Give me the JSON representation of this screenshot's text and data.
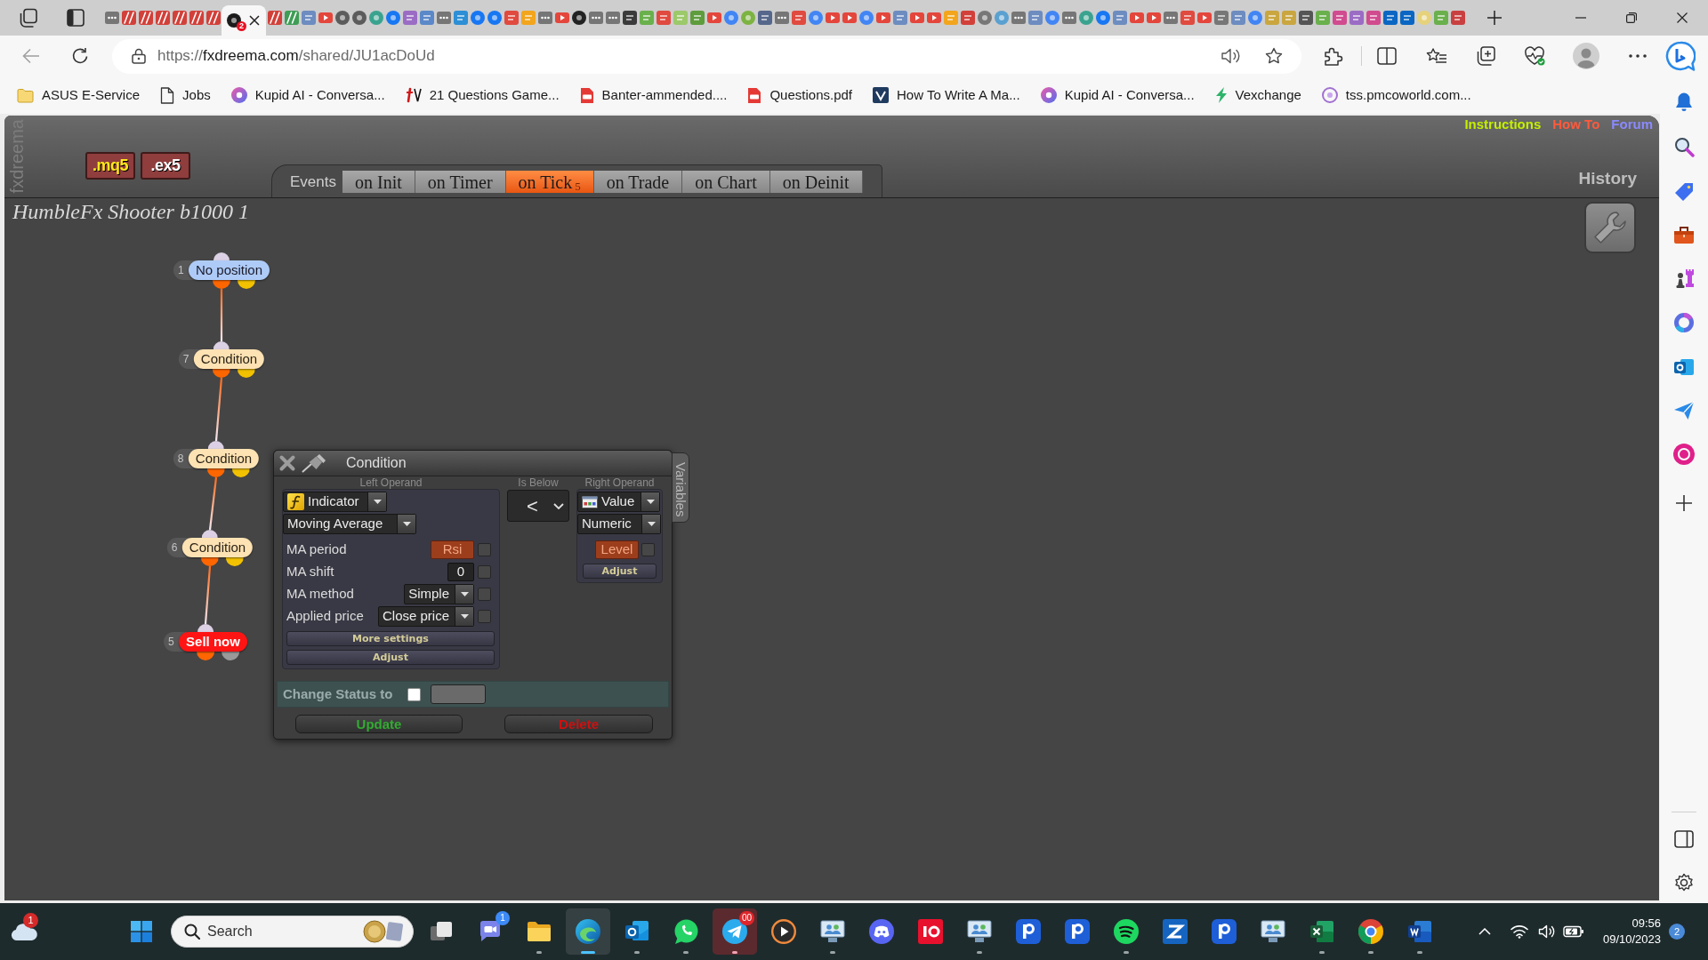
{
  "browser": {
    "tabs": [
      {
        "kind": "page",
        "color": "#767676",
        "selected": false
      },
      {
        "kind": "stripes",
        "color": "#d2403a",
        "selected": false
      },
      {
        "kind": "stripes",
        "color": "#d2403a",
        "selected": false
      },
      {
        "kind": "stripes",
        "color": "#d2403a",
        "selected": false
      },
      {
        "kind": "stripes",
        "color": "#d2403a",
        "selected": false
      },
      {
        "kind": "stripes",
        "color": "#d2403a",
        "selected": false
      },
      {
        "kind": "stripes",
        "color": "#d2403a",
        "selected": false
      },
      {
        "kind": "round",
        "color": "#1c1c1c",
        "badge": "2",
        "selected": true
      },
      {
        "kind": "stripes",
        "color": "#d2403a",
        "selected": false
      },
      {
        "kind": "stripes",
        "color": "#3f9d55",
        "selected": false
      },
      {
        "kind": "square",
        "color": "#6d8cc0",
        "selected": false
      },
      {
        "kind": "play",
        "color": "#e4463c",
        "selected": false
      },
      {
        "kind": "round",
        "color": "#5c5c5c",
        "selected": false
      },
      {
        "kind": "round",
        "color": "#5c5c5c",
        "selected": false
      },
      {
        "kind": "round",
        "color": "#3aa38f",
        "selected": false
      },
      {
        "kind": "round",
        "color": "#1877f2",
        "selected": false
      },
      {
        "kind": "square",
        "color": "#9b6cc4",
        "selected": false
      },
      {
        "kind": "square",
        "color": "#5b88c8",
        "selected": false
      },
      {
        "kind": "page",
        "color": "#767676",
        "selected": false
      },
      {
        "kind": "square",
        "color": "#2d8fd5",
        "selected": false
      },
      {
        "kind": "round",
        "color": "#1877f2",
        "selected": false
      },
      {
        "kind": "round",
        "color": "#1877f2",
        "selected": false
      },
      {
        "kind": "square",
        "color": "#e04a3f",
        "selected": false
      },
      {
        "kind": "square",
        "color": "#f2a51d",
        "selected": false
      },
      {
        "kind": "page",
        "color": "#767676",
        "selected": false
      },
      {
        "kind": "play",
        "color": "#e4463c",
        "selected": false
      },
      {
        "kind": "round",
        "color": "#222222",
        "selected": false
      },
      {
        "kind": "page",
        "color": "#767676",
        "selected": false
      },
      {
        "kind": "page",
        "color": "#767676",
        "selected": false
      },
      {
        "kind": "square",
        "color": "#3b3b3b",
        "selected": false
      },
      {
        "kind": "square",
        "color": "#6ab04c",
        "selected": false
      },
      {
        "kind": "square",
        "color": "#e04a3f",
        "selected": false
      },
      {
        "kind": "square",
        "color": "#9cc96a",
        "selected": false
      },
      {
        "kind": "square",
        "color": "#5e9c3c",
        "selected": false
      },
      {
        "kind": "play",
        "color": "#e4463c",
        "selected": false
      },
      {
        "kind": "round",
        "color": "#4285f4",
        "selected": false
      },
      {
        "kind": "round",
        "color": "#7cb342",
        "selected": false
      },
      {
        "kind": "square",
        "color": "#56678c",
        "selected": false
      },
      {
        "kind": "page",
        "color": "#767676",
        "selected": false
      },
      {
        "kind": "square",
        "color": "#e04a3f",
        "selected": false
      },
      {
        "kind": "round",
        "color": "#4285f4",
        "selected": false
      },
      {
        "kind": "play",
        "color": "#e4463c",
        "selected": false
      },
      {
        "kind": "play",
        "color": "#e4463c",
        "selected": false
      },
      {
        "kind": "round",
        "color": "#4285f4",
        "selected": false
      },
      {
        "kind": "play",
        "color": "#e4463c",
        "selected": false
      },
      {
        "kind": "square",
        "color": "#6d8cc0",
        "selected": false
      },
      {
        "kind": "play",
        "color": "#e4463c",
        "selected": false
      },
      {
        "kind": "play",
        "color": "#e4463c",
        "selected": false
      },
      {
        "kind": "square",
        "color": "#f2a51d",
        "selected": false
      },
      {
        "kind": "square",
        "color": "#d2403a",
        "selected": false
      },
      {
        "kind": "round",
        "color": "#777777",
        "selected": false
      },
      {
        "kind": "round",
        "color": "#5aa0d0",
        "selected": false
      },
      {
        "kind": "page",
        "color": "#767676",
        "selected": false
      },
      {
        "kind": "square",
        "color": "#6d8cc0",
        "selected": false
      },
      {
        "kind": "round",
        "color": "#4285f4",
        "selected": false
      },
      {
        "kind": "page",
        "color": "#767676",
        "selected": false
      },
      {
        "kind": "round",
        "color": "#3aa38f",
        "selected": false
      },
      {
        "kind": "round",
        "color": "#1877f2",
        "selected": false
      },
      {
        "kind": "square",
        "color": "#6d8cc0",
        "selected": false
      },
      {
        "kind": "play",
        "color": "#e4463c",
        "selected": false
      },
      {
        "kind": "play",
        "color": "#e4463c",
        "selected": false
      },
      {
        "kind": "page",
        "color": "#767676",
        "selected": false
      },
      {
        "kind": "square",
        "color": "#e04a3f",
        "selected": false
      },
      {
        "kind": "play",
        "color": "#e4463c",
        "selected": false
      },
      {
        "kind": "square",
        "color": "#777777",
        "selected": false
      },
      {
        "kind": "square",
        "color": "#6d8cc0",
        "selected": false
      },
      {
        "kind": "round",
        "color": "#4285f4",
        "selected": false
      },
      {
        "kind": "square",
        "color": "#c9a640",
        "selected": false
      },
      {
        "kind": "square",
        "color": "#c9a640",
        "selected": false
      },
      {
        "kind": "square",
        "color": "#555555",
        "selected": false
      },
      {
        "kind": "square",
        "color": "#6ab04c",
        "selected": false
      },
      {
        "kind": "square",
        "color": "#d14b8f",
        "selected": false
      },
      {
        "kind": "square",
        "color": "#9b6cc4",
        "selected": false
      },
      {
        "kind": "square",
        "color": "#d14b8f",
        "selected": false
      },
      {
        "kind": "square",
        "color": "#0a66c2",
        "selected": false
      },
      {
        "kind": "square",
        "color": "#0a66c2",
        "selected": false
      },
      {
        "kind": "round",
        "color": "#e6d27a",
        "selected": false
      },
      {
        "kind": "square",
        "color": "#6ab04c",
        "selected": false
      },
      {
        "kind": "square",
        "color": "#c94040",
        "selected": false
      }
    ],
    "address": {
      "scheme": "https://",
      "host": "fxdreema.com",
      "path": "/shared/JU1acDoUd"
    },
    "bookmarks": [
      {
        "kind": "folder",
        "label": "ASUS E-Service"
      },
      {
        "kind": "page",
        "label": "Jobs"
      },
      {
        "kind": "kupid",
        "label": "Kupid AI - Conversa..."
      },
      {
        "kind": "tv",
        "label": "21 Questions Game..."
      },
      {
        "kind": "pdf",
        "label": "Banter-ammended...."
      },
      {
        "kind": "pdf",
        "label": "Questions.pdf"
      },
      {
        "kind": "v",
        "label": "How To Write A Ma..."
      },
      {
        "kind": "kupid",
        "label": "Kupid AI - Conversa..."
      },
      {
        "kind": "bolt",
        "label": "Vexchange"
      },
      {
        "kind": "ring",
        "label": "tss.pmcoworld.com..."
      }
    ]
  },
  "app": {
    "brand": "fxdreema",
    "exports": [
      {
        "label": ".mq5",
        "kind": "mq5"
      },
      {
        "label": ".ex5",
        "kind": "ex5"
      }
    ],
    "events_label": "Events",
    "event_tabs": [
      {
        "label": "on Init",
        "selected": false
      },
      {
        "label": "on Timer",
        "selected": false
      },
      {
        "label": "on Tick",
        "count": "5",
        "selected": true
      },
      {
        "label": "on Trade",
        "selected": false
      },
      {
        "label": "on Chart",
        "selected": false
      },
      {
        "label": "on Deinit",
        "selected": false
      }
    ],
    "links": [
      {
        "label": "Instructions",
        "color": "#c4ef00"
      },
      {
        "label": "How To",
        "color": "#ff5a3c"
      },
      {
        "label": "Forum",
        "color": "#8a8aff"
      }
    ],
    "history": "History",
    "project_title": "HumbleFx Shooter b1000 1",
    "blocks": [
      {
        "number": "1",
        "label": "No position",
        "kind": "filter"
      },
      {
        "number": "7",
        "label": "Condition",
        "kind": "condition"
      },
      {
        "number": "8",
        "label": "Condition",
        "kind": "condition"
      },
      {
        "number": "6",
        "label": "Condition",
        "kind": "condition"
      },
      {
        "number": "5",
        "label": "Sell now",
        "kind": "action"
      }
    ],
    "dialog": {
      "title": "Condition",
      "side_tab": "Variables",
      "left_operand": {
        "heading": "Left Operand",
        "type": "Indicator",
        "indicator": "Moving Average",
        "params": [
          {
            "label": "MA period",
            "value": "Rsi",
            "kind": "variable",
            "checked": false
          },
          {
            "label": "MA shift",
            "value": "0",
            "kind": "number",
            "checked": false
          },
          {
            "label": "MA method",
            "value": "Simple",
            "kind": "select",
            "checked": false
          },
          {
            "label": "Applied price",
            "value": "Close price",
            "kind": "select",
            "checked": false
          }
        ],
        "buttons": [
          "More settings",
          "Adjust"
        ]
      },
      "operator": {
        "heading": "Is Below",
        "symbol": "<"
      },
      "right_operand": {
        "heading": "Right Operand",
        "type": "Value",
        "format": "Numeric",
        "value": "Level",
        "checked": false,
        "button": "Adjust"
      },
      "status": {
        "label": "Change Status to",
        "checked": false
      },
      "actions": [
        {
          "label": "Update",
          "kind": "update"
        },
        {
          "label": "Delete",
          "kind": "delete"
        }
      ]
    }
  },
  "taskbar": {
    "widgets_badge": "1",
    "search": {
      "placeholder": "Search"
    },
    "apps": [
      {
        "kind": "taskview",
        "running": false,
        "selected": false,
        "attention": false
      },
      {
        "kind": "chat",
        "running": false,
        "selected": false,
        "attention": false,
        "badge": "1"
      },
      {
        "kind": "explorer",
        "running": true,
        "selected": false,
        "attention": false
      },
      {
        "kind": "edge",
        "running": true,
        "selected": true,
        "attention": false
      },
      {
        "kind": "outlook",
        "running": true,
        "selected": false,
        "attention": false
      },
      {
        "kind": "whatsapp",
        "running": true,
        "selected": false,
        "attention": false
      },
      {
        "kind": "telegram",
        "running": true,
        "selected": false,
        "attention": true,
        "badge": "00"
      },
      {
        "kind": "media",
        "running": false,
        "selected": false,
        "attention": false
      },
      {
        "kind": "remote",
        "running": true,
        "selected": false,
        "attention": false
      },
      {
        "kind": "discord",
        "running": false,
        "selected": false,
        "attention": false
      },
      {
        "kind": "ig",
        "running": false,
        "selected": false,
        "attention": false
      },
      {
        "kind": "remote",
        "running": true,
        "selected": false,
        "attention": false
      },
      {
        "kind": "ptile",
        "running": false,
        "selected": false,
        "attention": false
      },
      {
        "kind": "ptile",
        "running": false,
        "selected": false,
        "attention": false
      },
      {
        "kind": "spotify",
        "running": true,
        "selected": false,
        "attention": false
      },
      {
        "kind": "ztile",
        "running": false,
        "selected": false,
        "attention": false
      },
      {
        "kind": "ptile",
        "running": false,
        "selected": false,
        "attention": false
      },
      {
        "kind": "remote",
        "running": false,
        "selected": false,
        "attention": false
      },
      {
        "kind": "excel",
        "running": true,
        "selected": false,
        "attention": false
      },
      {
        "kind": "chrome",
        "running": true,
        "selected": false,
        "attention": false
      },
      {
        "kind": "word",
        "running": true,
        "selected": false,
        "attention": false
      }
    ],
    "time": "09:56",
    "date": "09/10/2023",
    "notification_count": "2"
  }
}
